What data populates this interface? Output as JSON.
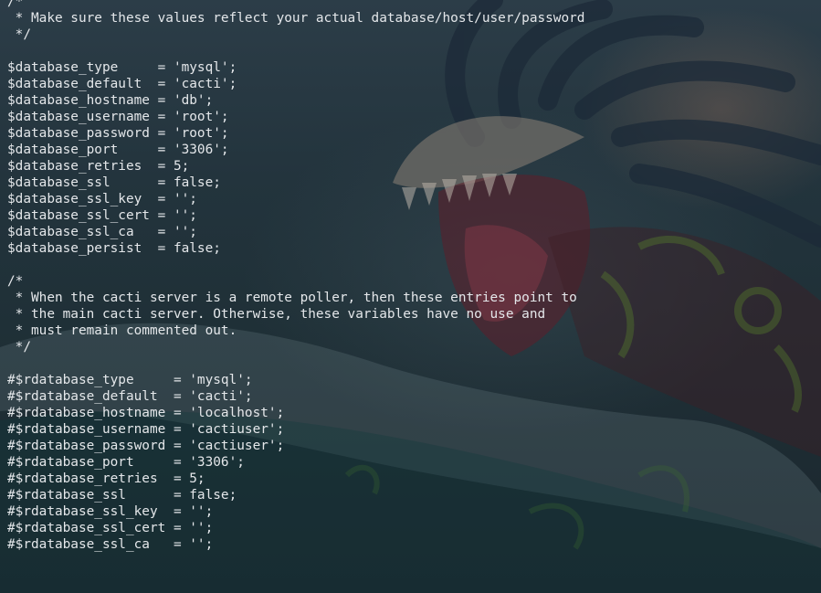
{
  "terminal": {
    "lines": [
      "/*",
      " * Make sure these values reflect your actual database/host/user/password",
      " */",
      "",
      "$database_type     = 'mysql';",
      "$database_default  = 'cacti';",
      "$database_hostname = 'db';",
      "$database_username = 'root';",
      "$database_password = 'root';",
      "$database_port     = '3306';",
      "$database_retries  = 5;",
      "$database_ssl      = false;",
      "$database_ssl_key  = '';",
      "$database_ssl_cert = '';",
      "$database_ssl_ca   = '';",
      "$database_persist  = false;",
      "",
      "/*",
      " * When the cacti server is a remote poller, then these entries point to",
      " * the main cacti server. Otherwise, these variables have no use and",
      " * must remain commented out.",
      " */",
      "",
      "#$rdatabase_type     = 'mysql';",
      "#$rdatabase_default  = 'cacti';",
      "#$rdatabase_hostname = 'localhost';",
      "#$rdatabase_username = 'cactiuser';",
      "#$rdatabase_password = 'cactiuser';",
      "#$rdatabase_port     = '3306';",
      "#$rdatabase_retries  = 5;",
      "#$rdatabase_ssl      = false;",
      "#$rdatabase_ssl_key  = '';",
      "#$rdatabase_ssl_cert = '';",
      "#$rdatabase_ssl_ca   = '';"
    ]
  },
  "colors": {
    "text": "#e4e7ea",
    "background": "#23343d"
  }
}
